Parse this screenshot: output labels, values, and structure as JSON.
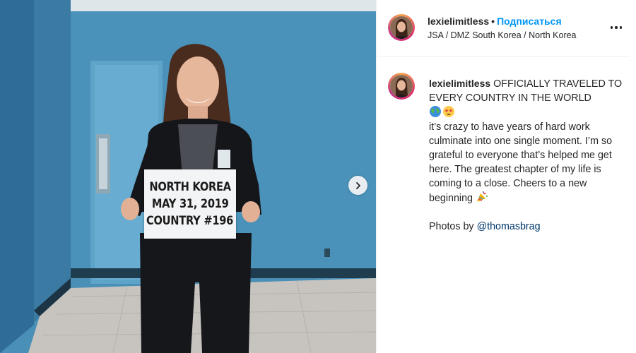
{
  "post": {
    "username": "lexielimitless",
    "follow_label": "Подписаться",
    "location": "JSA / DMZ South Korea / North Korea"
  },
  "caption": {
    "username": "lexielimitless",
    "headline": "OFFICIALLY TRAVELED TO EVERY COUNTRY IN THE WORLD",
    "headline_emojis": [
      "globe-emoji",
      "star-struck-emoji"
    ],
    "body": "it’s crazy to have years of hard work culminate into one single moment. I’m so grateful to everyone that’s helped me get here. The greatest chapter of my life is coming to a close. Cheers to a new beginning",
    "body_emoji": "party-popper-emoji",
    "credit_prefix": "Photos by",
    "credit_mention": "@thomasbrag"
  },
  "photo": {
    "sign_lines": [
      "NORTH KOREA",
      "MAY 31, 2019",
      "COUNTRY #196"
    ]
  },
  "icons": {
    "next": "chevron-right-icon",
    "more": "more-options-icon"
  },
  "colors": {
    "follow": "#0095f6",
    "mention": "#00376b",
    "text": "#262626",
    "wall": "#3e86ae"
  }
}
